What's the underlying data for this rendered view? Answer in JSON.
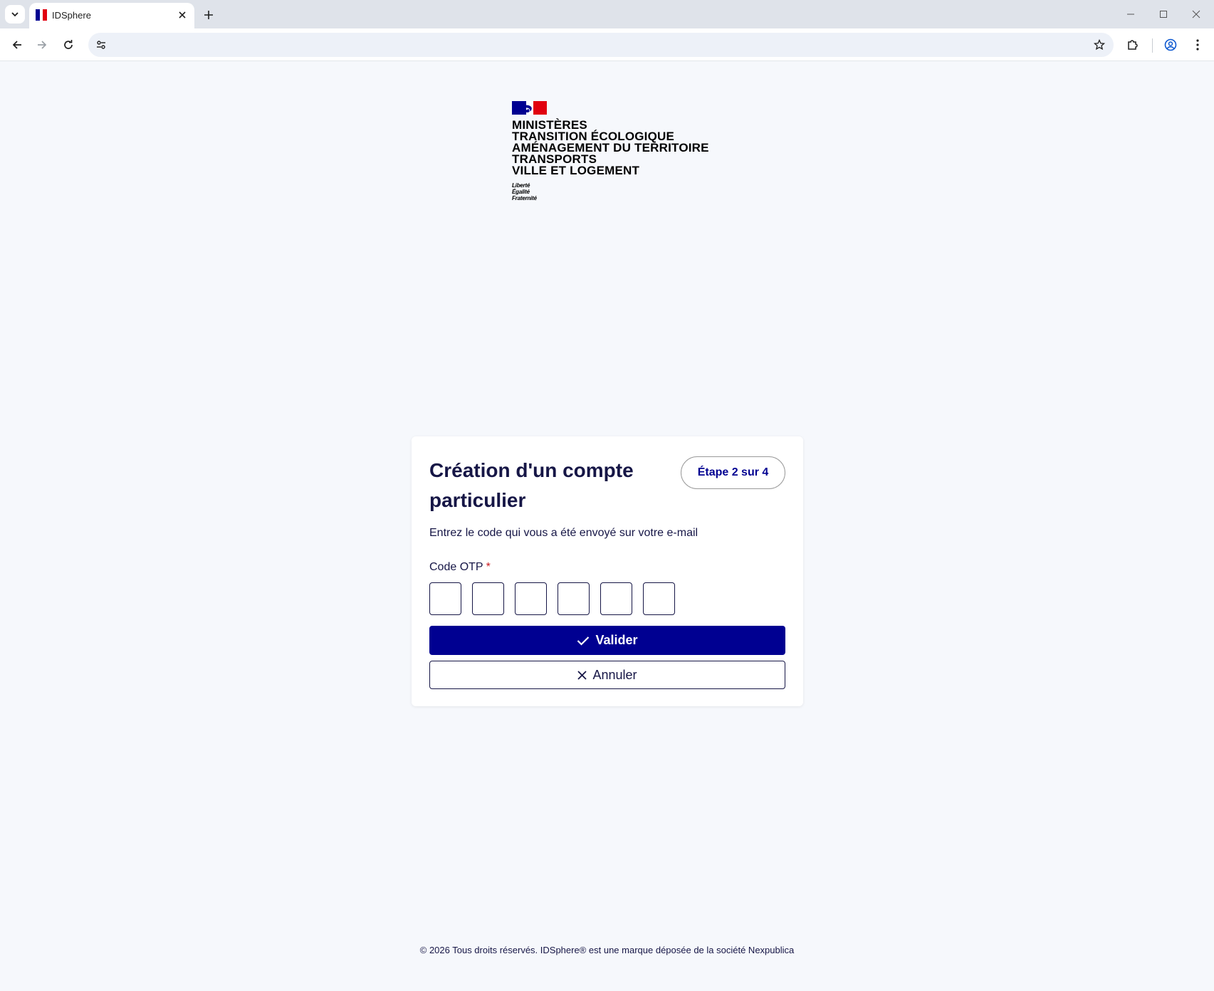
{
  "browser": {
    "tab_title": "IDSphere",
    "address": ""
  },
  "logo": {
    "ministry_lines": [
      "MINISTÈRES",
      "TRANSITION ÉCOLOGIQUE",
      "AMÉNAGEMENT DU TERRITOIRE",
      "TRANSPORTS",
      "VILLE ET LOGEMENT"
    ],
    "motto_lines": [
      "Liberté",
      "Égalité",
      "Fraternité"
    ],
    "flag_colors": {
      "blue": "#000091",
      "white": "#ffffff",
      "red": "#e1000f"
    }
  },
  "card": {
    "title": "Création d'un compte particulier",
    "step": "Étape 2 sur 4",
    "description": "Entrez le code qui vous a été envoyé sur votre e-mail",
    "otp_label": "Code OTP",
    "otp_required_marker": "*",
    "otp_values": [
      "",
      "",
      "",
      "",
      "",
      ""
    ],
    "submit_label": "Valider",
    "cancel_label": "Annuler"
  },
  "footer": {
    "text": "© 2026 Tous droits réservés. IDSphere® est une marque déposée de la société Nexpublica"
  },
  "colors": {
    "primary": "#000091",
    "text": "#161646",
    "background": "#f6f8fc",
    "required": "#c9191e"
  }
}
